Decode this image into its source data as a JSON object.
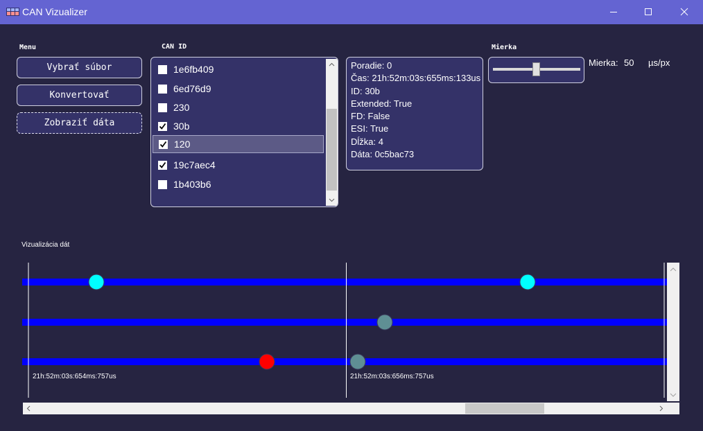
{
  "window": {
    "title": "CAN Vizualizer",
    "controls": [
      "minimize",
      "maximize",
      "close"
    ]
  },
  "menu": {
    "label": "Menu",
    "buttons": [
      "Vybrať súbor",
      "Konvertovať",
      "Zobraziť dáta"
    ]
  },
  "can_id": {
    "label": "CAN ID",
    "items": [
      {
        "label": "1e6fb409",
        "checked": false
      },
      {
        "label": "6ed76d9",
        "checked": false
      },
      {
        "label": "230",
        "checked": false
      },
      {
        "label": "30b",
        "checked": true
      },
      {
        "label": "120",
        "checked": true,
        "selected": true
      },
      {
        "label": "19c7aec4",
        "checked": true
      },
      {
        "label": "1b403b6",
        "checked": false
      }
    ]
  },
  "info": {
    "lines": [
      "Poradie: 0",
      "Čas: 21h:52m:03s:655ms:133us",
      "ID: 30b",
      "Extended: True",
      "FD: False",
      "ESI: True",
      "Dĺžka: 4",
      "Dáta: 0c5bac73"
    ]
  },
  "scale": {
    "label": "Mierka",
    "slider_value": 0.5,
    "value_label": "Mierka:",
    "value": "50",
    "unit": "µs/px"
  },
  "visualization": {
    "label": "Vizualizácia dát",
    "tracks": 3,
    "markers": [
      {
        "track": 0,
        "color": "#00ffff"
      },
      {
        "track": 0,
        "color": "#00ffff"
      },
      {
        "track": 1,
        "color": "#5f8f94"
      },
      {
        "track": 2,
        "color": "#ff0000"
      },
      {
        "track": 2,
        "color": "#5f8f94"
      }
    ],
    "time_labels": [
      "21h:52m:03s:654ms:757us",
      "21h:52m:03s:656ms:757us"
    ],
    "horizontal_scroll_position": 0.67
  },
  "colors": {
    "background": "#262441",
    "titlebar": "#6464d2",
    "panel": "#343268",
    "track": "#0000ff"
  }
}
